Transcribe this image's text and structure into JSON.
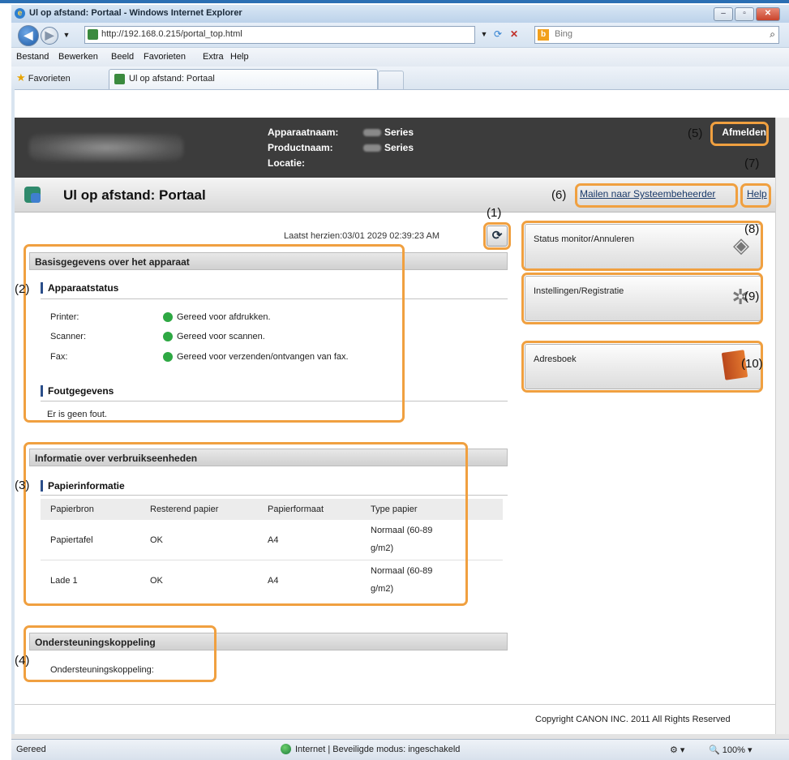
{
  "window": {
    "title": "Ul op afstand: Portaal",
    "title_suffix": " - Windows Internet Explorer",
    "minimize": "–",
    "maximize": "▫",
    "close": "✕"
  },
  "address_bar": {
    "back": "◀",
    "forward": "▶",
    "url": "http://192.168.0.215/portal_top.html",
    "search_placeholder": "Bing",
    "search_logo": "b"
  },
  "menu": [
    "Bestand",
    "Bewerken",
    "Beeld",
    "Favorieten",
    "Extra",
    "Help"
  ],
  "favorites_bar": {
    "favorites_label": "Favorieten",
    "tab_title": "Ul op afstand: Portaal"
  },
  "device_header": {
    "device_name_label": "Apparaatnaam:",
    "device_name_value": "Series",
    "product_name_label": "Productnaam:",
    "product_name_value": "Series",
    "location_label": "Locatie:",
    "logout": "Afmelden"
  },
  "portal_bar": {
    "title": "Ul op afstand: Portaal",
    "mail_link": "Mailen naar Systeembeheerder",
    "help_link": "Help"
  },
  "last_revised": "Laatst herzien:03/01 2029 02:39:23 AM",
  "basic_info": {
    "header": "Basisgegevens over het apparaat",
    "status_title": "Apparaatstatus",
    "rows": [
      {
        "label": "Printer:",
        "status": "Gereed voor afdrukken."
      },
      {
        "label": "Scanner:",
        "status": "Gereed voor scannen."
      },
      {
        "label": "Fax:",
        "status": "Gereed voor verzenden/ontvangen van fax."
      }
    ],
    "status_color": "#2ea843",
    "error_title": "Foutgegevens",
    "error_text": "Er is geen fout."
  },
  "consumables": {
    "header": "Informatie over verbruikseenheden",
    "paper_title": "Papierinformatie",
    "columns": [
      "Papierbron",
      "Resterend papier",
      "Papierformaat",
      "Type papier"
    ],
    "rows": [
      {
        "source": "Papiertafel",
        "remaining": "OK",
        "size": "A4",
        "type_line1": "Normaal (60-89",
        "type_line2": "g/m2)"
      },
      {
        "source": "Lade 1",
        "remaining": "OK",
        "size": "A4",
        "type_line1": "Normaal (60-89",
        "type_line2": "g/m2)"
      }
    ]
  },
  "support": {
    "header": "Ondersteuningskoppeling",
    "text": "Ondersteuningskoppeling:"
  },
  "right_panel": {
    "status_monitor": "Status monitor/Annuleren",
    "settings": "Instellingen/Registratie",
    "address_book": "Adresboek"
  },
  "callouts": [
    "(1)",
    "(2)",
    "(3)",
    "(4)",
    "(5)",
    "(6)",
    "(7)",
    "(8)",
    "(9)",
    "(10)"
  ],
  "callout_color": "#f0a040",
  "footer": {
    "copyright": "Copyright CANON INC. 2011 All Rights Reserved"
  },
  "status_bar": {
    "left": "Gereed",
    "zone": "Internet | Beveiligde modus: ingeschakeld",
    "zoom": "100%"
  }
}
